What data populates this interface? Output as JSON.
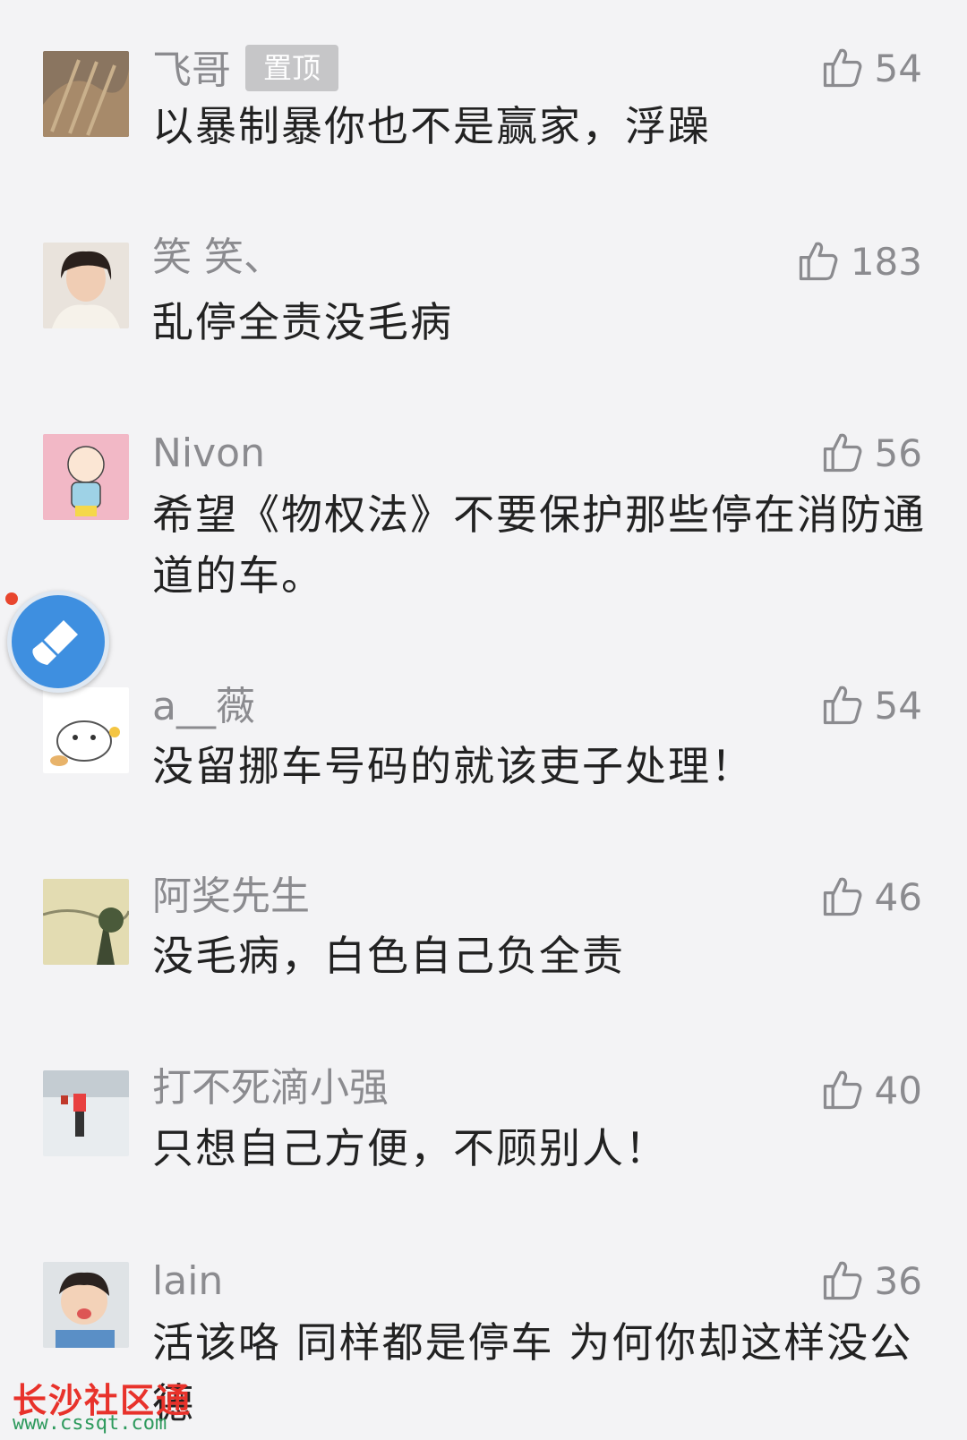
{
  "comments": [
    {
      "name": "飞哥",
      "pin_label": "置顶",
      "likes": "54",
      "text": "以暴制暴你也不是赢家，浮躁"
    },
    {
      "name": "笑 笑、",
      "likes": "183",
      "text": "乱停全责没毛病"
    },
    {
      "name": "Nivon",
      "likes": "56",
      "text": "希望《物权法》不要保护那些停在消防通道的车。"
    },
    {
      "name": "a__薇",
      "likes": "54",
      "text": "没留挪车号码的就该吏子处理！"
    },
    {
      "name": "阿奖先生",
      "likes": "46",
      "text": "没毛病，白色自己负全责"
    },
    {
      "name": "打不死滴小强",
      "likes": "40",
      "text": "只想自己方便，不顾别人！"
    },
    {
      "name": "lain",
      "likes": "36",
      "text": "活该咯 同样都是停车 为何你却这样没公德"
    }
  ],
  "watermark": {
    "site_name": "长沙社区通",
    "url": "www.cssqt.com"
  },
  "icons": {
    "like": "thumbs-up-icon",
    "floating": "broom-icon"
  },
  "colors": {
    "background": "#f3f3f5",
    "name": "#8b8b8f",
    "text": "#222222",
    "pin_bg": "#c6c6c8",
    "float_btn": "#3e8fe0",
    "watermark_cn": "#e8322b",
    "watermark_url": "#2e9a5d"
  }
}
